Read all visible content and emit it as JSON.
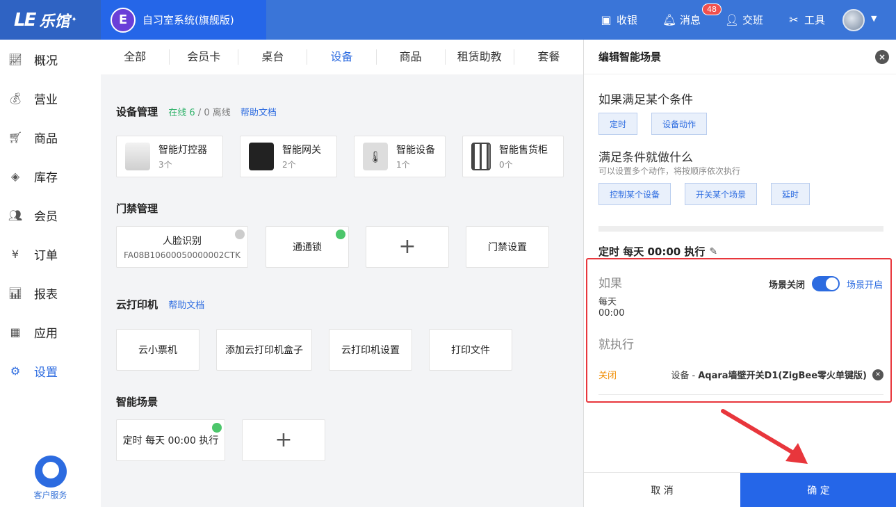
{
  "brand": {
    "logo_mark": "LE",
    "logo_text": "乐馆",
    "logo_star": "✦",
    "app_icon": "E",
    "app_title": "自习室系统(旗舰版)"
  },
  "topbar": {
    "cashier": "收银",
    "messages": "消息",
    "messages_badge": "48",
    "handover": "交班",
    "tools": "工具"
  },
  "sidebar": {
    "items": [
      {
        "label": "概况",
        "icon": "chart-icon"
      },
      {
        "label": "营业",
        "icon": "money-bag-icon"
      },
      {
        "label": "商品",
        "icon": "cart-icon"
      },
      {
        "label": "库存",
        "icon": "layers-icon"
      },
      {
        "label": "会员",
        "icon": "user-icon"
      },
      {
        "label": "订单",
        "icon": "order-icon"
      },
      {
        "label": "报表",
        "icon": "bar-chart-icon"
      },
      {
        "label": "应用",
        "icon": "grid-icon"
      },
      {
        "label": "设置",
        "icon": "gear-icon"
      }
    ],
    "service": "客户服务"
  },
  "tabs": [
    "全部",
    "会员卡",
    "桌台",
    "设备",
    "商品",
    "租赁助教",
    "套餐"
  ],
  "device_mgmt": {
    "title": "设备管理",
    "online": "在线 6",
    "slash": "/",
    "offline": "0 离线",
    "help": "帮助文档",
    "devices": [
      {
        "name": "智能灯控器",
        "count": "3个"
      },
      {
        "name": "智能网关",
        "count": "2个"
      },
      {
        "name": "智能设备",
        "count": "1个"
      },
      {
        "name": "智能售货柜",
        "count": "0个"
      }
    ]
  },
  "access": {
    "title": "门禁管理",
    "face_name": "人脸识别",
    "face_serial": "FA08B10600050000002CTK",
    "lock": "通通锁",
    "plus": "+",
    "settings": "门禁设置"
  },
  "printer": {
    "title": "云打印机",
    "help": "帮助文档",
    "items": [
      "云小票机",
      "添加云打印机盒子",
      "云打印机设置",
      "打印文件"
    ]
  },
  "scenes": {
    "title": "智能场景",
    "scene1": "定时 每天 00:00 执行",
    "plus": "+"
  },
  "panel": {
    "title": "编辑智能场景",
    "close": "×",
    "if_title": "如果满足某个条件",
    "if_buttons": [
      "定时",
      "设备动作"
    ],
    "do_title": "满足条件就做什么",
    "do_desc": "可以设置多个动作，将按顺序依次执行",
    "do_buttons": [
      "控制某个设备",
      "开关某个场景",
      "延时"
    ],
    "schedule": "定时 每天 00:00 执行",
    "if_label": "如果",
    "freq": "每天",
    "time": "00:00",
    "toggle_off": "场景关闭",
    "toggle_on": "场景开启",
    "exec_label": "就执行",
    "action_state": "关闭",
    "action_prefix": "设备 -",
    "action_device": "Aqara墙壁开关D1(ZigBee零火单键版)",
    "cancel": "取 消",
    "confirm": "确 定"
  },
  "colors": {
    "primary": "#2566e8",
    "online": "#4cc66b",
    "alert": "#e8363c",
    "orange": "#f08c00"
  }
}
